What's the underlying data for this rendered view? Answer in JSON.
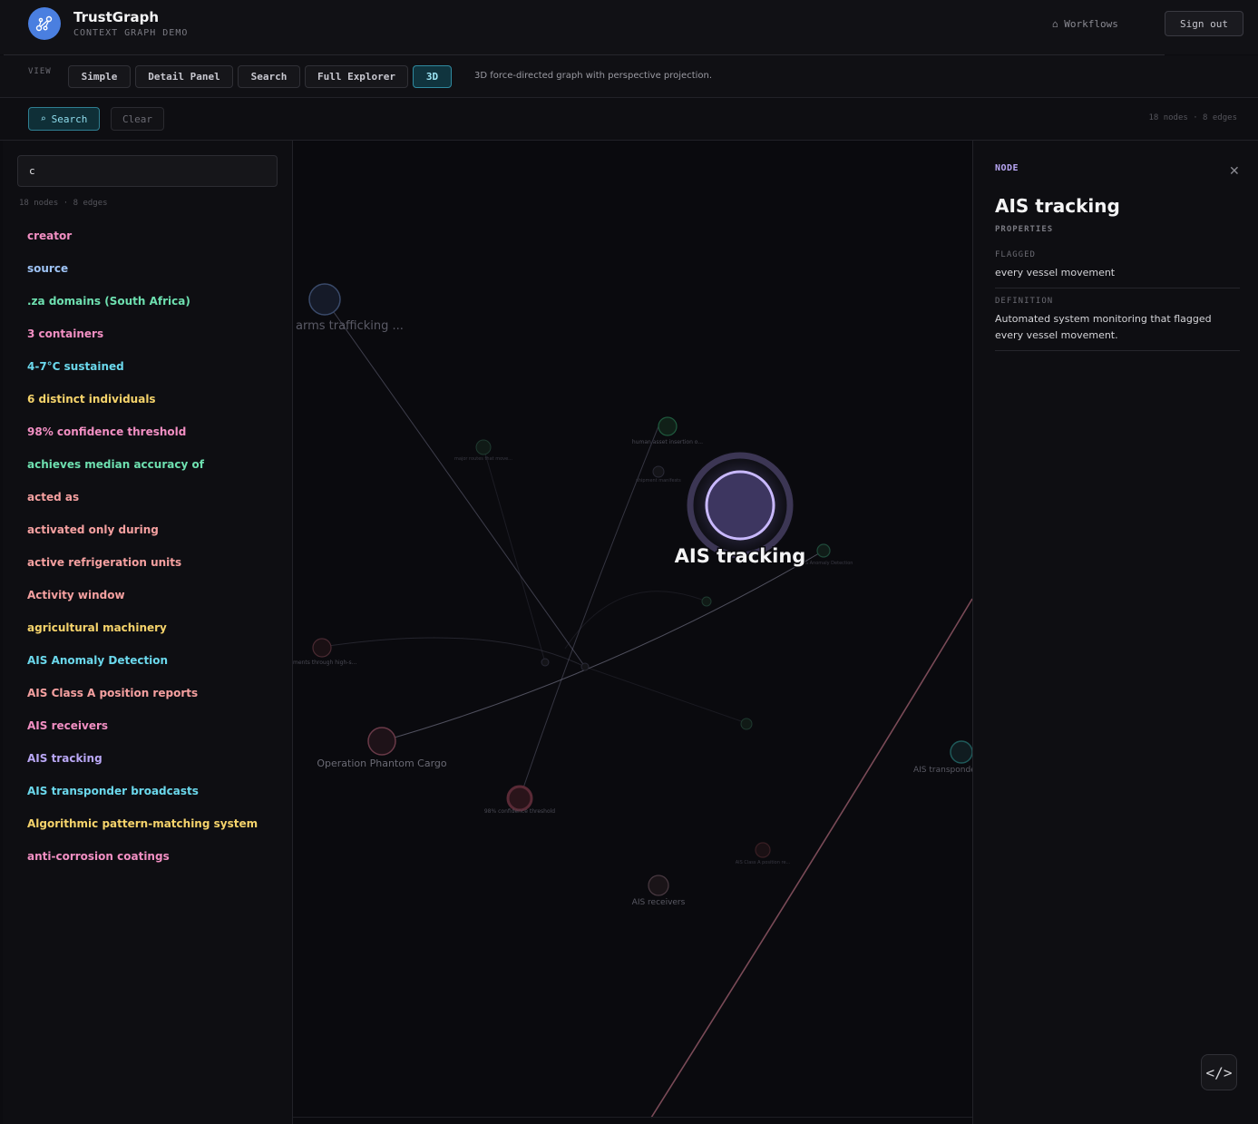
{
  "app": {
    "name": "TrustGraph",
    "subtitle": "CONTEXT GRAPH DEMO",
    "workflows_label": "Workflows",
    "signout_label": "Sign out"
  },
  "view": {
    "label": "VIEW",
    "buttons": [
      "Simple",
      "Detail Panel",
      "Search",
      "Full Explorer",
      "3D"
    ],
    "active": "3D",
    "description": "3D force-directed graph with perspective projection."
  },
  "actions": {
    "search_label": "Search",
    "clear_label": "Clear",
    "counts": "18 nodes · 8 edges"
  },
  "left": {
    "search_value": "c",
    "counts": "18 nodes · 8 edges",
    "items": [
      {
        "label": "creator",
        "color": "#f28fc3"
      },
      {
        "label": "source",
        "color": "#9ec3f5"
      },
      {
        "label": ".za domains (South Africa)",
        "color": "#6ee0b0"
      },
      {
        "label": "3 containers",
        "color": "#f28fc3"
      },
      {
        "label": "4-7°C sustained",
        "color": "#6bd8ec"
      },
      {
        "label": "6 distinct individuals",
        "color": "#f5d36b"
      },
      {
        "label": "98% confidence threshold",
        "color": "#f28fc3"
      },
      {
        "label": "achieves median accuracy of",
        "color": "#6ee0b0"
      },
      {
        "label": "acted as",
        "color": "#f5a0a0"
      },
      {
        "label": "activated only during",
        "color": "#f5a0a0"
      },
      {
        "label": "active refrigeration units",
        "color": "#f5a0a0"
      },
      {
        "label": "Activity window",
        "color": "#f5a0a0"
      },
      {
        "label": "agricultural machinery",
        "color": "#f5d36b"
      },
      {
        "label": "AIS Anomaly Detection",
        "color": "#6bd8ec"
      },
      {
        "label": "AIS Class A position reports",
        "color": "#f5a0a0"
      },
      {
        "label": "AIS receivers",
        "color": "#f28fc3"
      },
      {
        "label": "AIS tracking",
        "color": "#b9a7f5"
      },
      {
        "label": "AIS transponder broadcasts",
        "color": "#6bd8ec"
      },
      {
        "label": "Algorithmic pattern-matching system",
        "color": "#f5d36b"
      },
      {
        "label": "anti-corrosion coatings",
        "color": "#f28fc3"
      }
    ]
  },
  "graph": {
    "selected_label": "AIS tracking",
    "labels": {
      "arms": "arms trafficking ...",
      "phantom": "Operation Phantom Cargo",
      "receivers": "AIS receivers",
      "transponder": "AIS transponder",
      "confidence": "98% confidence threshold",
      "human": "human asset insertion o...",
      "ments": "ments through high-s...",
      "anomaly": "AIS Anomaly Detection",
      "classa": "AIS Class A position re...",
      "small1": "major routes that move...",
      "small2": "shipment manifests"
    }
  },
  "detail": {
    "type_label": "NODE",
    "title": "AIS tracking",
    "properties_label": "PROPERTIES",
    "properties": [
      {
        "key": "FLAGGED",
        "value": "every vessel movement"
      },
      {
        "key": "DEFINITION",
        "value": "Automated system monitoring that flagged every vessel movement."
      }
    ],
    "code_label": "</>"
  }
}
